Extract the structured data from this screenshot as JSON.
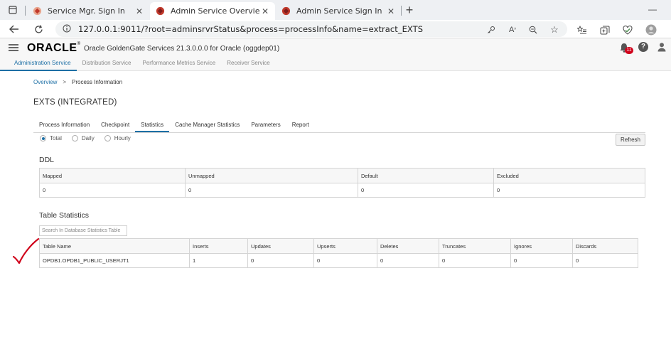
{
  "browser": {
    "tabs": [
      {
        "title": "Service Mgr. Sign In",
        "active": false
      },
      {
        "title": "Admin Service Overview | Proces",
        "active": true
      },
      {
        "title": "Admin Service Sign In",
        "active": false
      }
    ],
    "url": "127.0.0.1:9011/?root=adminsrvrStatus&process=processInfo&name=extract_EXTS"
  },
  "header": {
    "logo": "ORACLE",
    "product": "Oracle GoldenGate Services 21.3.0.0.0 for Oracle (oggdep01)",
    "notification_count": "11",
    "services": [
      {
        "label": "Administration Service",
        "active": true
      },
      {
        "label": "Distribution Service",
        "active": false
      },
      {
        "label": "Performance Metrics Service",
        "active": false
      },
      {
        "label": "Receiver Service",
        "active": false
      }
    ]
  },
  "breadcrumb": {
    "overview": "Overview",
    "separator": ">",
    "current": "Process Information"
  },
  "page_title": "EXTS (INTEGRATED)",
  "tabs": [
    {
      "label": "Process Information",
      "active": false
    },
    {
      "label": "Checkpoint",
      "active": false
    },
    {
      "label": "Statistics",
      "active": true
    },
    {
      "label": "Cache Manager Statistics",
      "active": false
    },
    {
      "label": "Parameters",
      "active": false
    },
    {
      "label": "Report",
      "active": false
    }
  ],
  "stat_modes": [
    {
      "label": "Total",
      "selected": true
    },
    {
      "label": "Daily",
      "selected": false
    },
    {
      "label": "Hourly",
      "selected": false
    }
  ],
  "refresh_label": "Refresh",
  "ddl": {
    "title": "DDL",
    "columns": [
      "Mapped",
      "Unmapped",
      "Default",
      "Excluded"
    ],
    "row": [
      "0",
      "0",
      "0",
      "0"
    ]
  },
  "table_stats": {
    "title": "Table Statistics",
    "search_placeholder": "Search In Database Statistics Table",
    "columns": [
      "Table Name",
      "Inserts",
      "Updates",
      "Upserts",
      "Deletes",
      "Truncates",
      "Ignores",
      "Discards"
    ],
    "rows": [
      [
        "OPDB1.OPDB1_PUBLIC_USERJT1",
        "1",
        "0",
        "0",
        "0",
        "0",
        "0",
        "0"
      ]
    ]
  },
  "colors": {
    "accent": "#1d6fa5",
    "checkmark": "#d0021b"
  }
}
